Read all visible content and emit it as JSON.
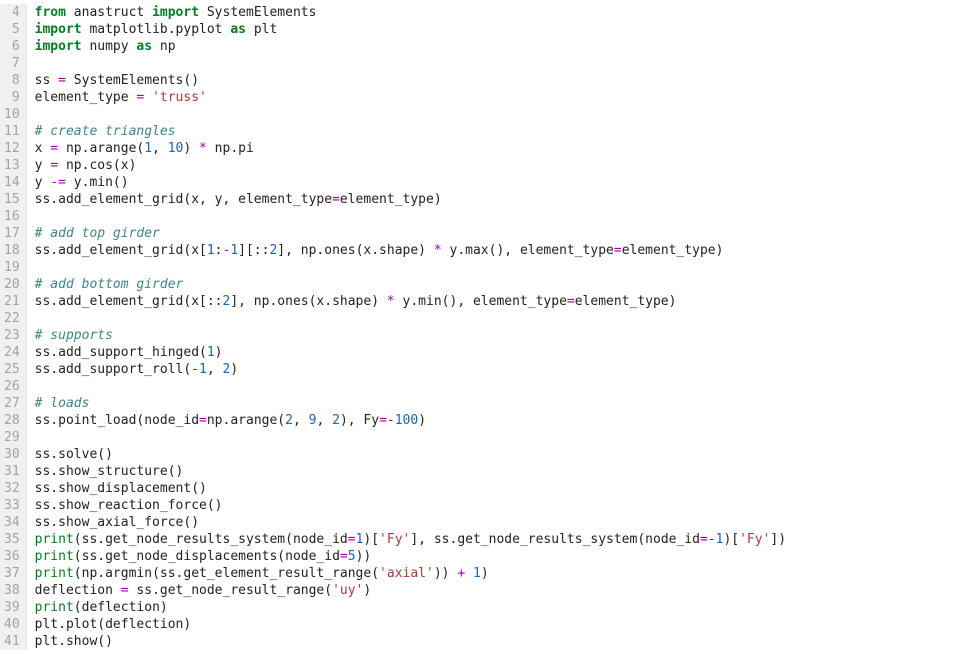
{
  "lines": [
    {
      "n": 4,
      "t": [
        [
          "kw",
          "from"
        ],
        [
          "",
          " anastruct "
        ],
        [
          "kw",
          "import"
        ],
        [
          "",
          " SystemElements"
        ]
      ]
    },
    {
      "n": 5,
      "t": [
        [
          "kw",
          "import"
        ],
        [
          "",
          " matplotlib.pyplot "
        ],
        [
          "kw",
          "as"
        ],
        [
          "",
          " plt"
        ]
      ]
    },
    {
      "n": 6,
      "t": [
        [
          "kw",
          "import"
        ],
        [
          "",
          " numpy "
        ],
        [
          "kw",
          "as"
        ],
        [
          "",
          " np"
        ]
      ]
    },
    {
      "n": 7,
      "t": []
    },
    {
      "n": 8,
      "t": [
        [
          "",
          "ss "
        ],
        [
          "opc",
          "="
        ],
        [
          "",
          " SystemElements()"
        ]
      ]
    },
    {
      "n": 9,
      "t": [
        [
          "",
          "element_type "
        ],
        [
          "opc",
          "="
        ],
        [
          "",
          " "
        ],
        [
          "str",
          "'truss'"
        ]
      ]
    },
    {
      "n": 10,
      "t": []
    },
    {
      "n": 11,
      "t": [
        [
          "com",
          "# create triangles"
        ]
      ]
    },
    {
      "n": 12,
      "t": [
        [
          "",
          "x "
        ],
        [
          "opc",
          "="
        ],
        [
          "",
          " np.arange("
        ],
        [
          "num",
          "1"
        ],
        [
          "",
          ", "
        ],
        [
          "num",
          "10"
        ],
        [
          "",
          ") "
        ],
        [
          "opc",
          "*"
        ],
        [
          "",
          " np.pi"
        ]
      ]
    },
    {
      "n": 13,
      "t": [
        [
          "",
          "y "
        ],
        [
          "opc",
          "="
        ],
        [
          "",
          " np.cos(x)"
        ]
      ]
    },
    {
      "n": 14,
      "t": [
        [
          "",
          "y "
        ],
        [
          "opc",
          "-="
        ],
        [
          "",
          " y.min()"
        ]
      ]
    },
    {
      "n": 15,
      "t": [
        [
          "",
          "ss.add_element_grid(x, y, element_type"
        ],
        [
          "opc",
          "="
        ],
        [
          "",
          "element_type)"
        ]
      ]
    },
    {
      "n": 16,
      "t": []
    },
    {
      "n": 17,
      "t": [
        [
          "com",
          "# add top girder"
        ]
      ]
    },
    {
      "n": 18,
      "t": [
        [
          "",
          "ss.add_element_grid(x["
        ],
        [
          "num",
          "1"
        ],
        [
          "",
          ":"
        ],
        [
          "opc",
          "-"
        ],
        [
          "num",
          "1"
        ],
        [
          "",
          "][::"
        ],
        [
          "num",
          "2"
        ],
        [
          "",
          "], np.ones(x.shape) "
        ],
        [
          "opc",
          "*"
        ],
        [
          "",
          " y.max(), element_type"
        ],
        [
          "opc",
          "="
        ],
        [
          "",
          "element_type)"
        ]
      ]
    },
    {
      "n": 19,
      "t": []
    },
    {
      "n": 20,
      "t": [
        [
          "com",
          "# add bottom girder"
        ]
      ]
    },
    {
      "n": 21,
      "t": [
        [
          "",
          "ss.add_element_grid(x[::"
        ],
        [
          "num",
          "2"
        ],
        [
          "",
          "], np.ones(x.shape) "
        ],
        [
          "opc",
          "*"
        ],
        [
          "",
          " y.min(), element_type"
        ],
        [
          "opc",
          "="
        ],
        [
          "",
          "element_type)"
        ]
      ]
    },
    {
      "n": 22,
      "t": []
    },
    {
      "n": 23,
      "t": [
        [
          "com",
          "# supports"
        ]
      ]
    },
    {
      "n": 24,
      "t": [
        [
          "",
          "ss.add_support_hinged("
        ],
        [
          "num",
          "1"
        ],
        [
          "",
          ")"
        ]
      ]
    },
    {
      "n": 25,
      "t": [
        [
          "",
          "ss.add_support_roll("
        ],
        [
          "opc",
          "-"
        ],
        [
          "num",
          "1"
        ],
        [
          "",
          ", "
        ],
        [
          "num",
          "2"
        ],
        [
          "",
          ")"
        ]
      ]
    },
    {
      "n": 26,
      "t": []
    },
    {
      "n": 27,
      "t": [
        [
          "com",
          "# loads"
        ]
      ]
    },
    {
      "n": 28,
      "t": [
        [
          "",
          "ss.point_load(node_id"
        ],
        [
          "opc",
          "="
        ],
        [
          "",
          "np.arange("
        ],
        [
          "num",
          "2"
        ],
        [
          "",
          ", "
        ],
        [
          "num",
          "9"
        ],
        [
          "",
          ", "
        ],
        [
          "num",
          "2"
        ],
        [
          "",
          "), Fy"
        ],
        [
          "opc",
          "=-"
        ],
        [
          "num",
          "100"
        ],
        [
          "",
          ")"
        ]
      ]
    },
    {
      "n": 29,
      "t": []
    },
    {
      "n": 30,
      "t": [
        [
          "",
          "ss.solve()"
        ]
      ]
    },
    {
      "n": 31,
      "t": [
        [
          "",
          "ss.show_structure()"
        ]
      ]
    },
    {
      "n": 32,
      "t": [
        [
          "",
          "ss.show_displacement()"
        ]
      ]
    },
    {
      "n": 33,
      "t": [
        [
          "",
          "ss.show_reaction_force()"
        ]
      ]
    },
    {
      "n": 34,
      "t": [
        [
          "",
          "ss.show_axial_force()"
        ]
      ]
    },
    {
      "n": 35,
      "t": [
        [
          "fn",
          "print"
        ],
        [
          "",
          "(ss.get_node_results_system(node_id"
        ],
        [
          "opc",
          "="
        ],
        [
          "num",
          "1"
        ],
        [
          "",
          ")["
        ],
        [
          "str",
          "'Fy'"
        ],
        [
          "",
          "], ss.get_node_results_system(node_id"
        ],
        [
          "opc",
          "=-"
        ],
        [
          "num",
          "1"
        ],
        [
          "",
          ")["
        ],
        [
          "str",
          "'Fy'"
        ],
        [
          "",
          "])"
        ]
      ]
    },
    {
      "n": 36,
      "t": [
        [
          "fn",
          "print"
        ],
        [
          "",
          "(ss.get_node_displacements(node_id"
        ],
        [
          "opc",
          "="
        ],
        [
          "num",
          "5"
        ],
        [
          "",
          "))"
        ]
      ]
    },
    {
      "n": 37,
      "t": [
        [
          "fn",
          "print"
        ],
        [
          "",
          "(np.argmin(ss.get_element_result_range("
        ],
        [
          "str",
          "'axial'"
        ],
        [
          "",
          ")) "
        ],
        [
          "opc",
          "+"
        ],
        [
          "",
          " "
        ],
        [
          "num",
          "1"
        ],
        [
          "",
          ")"
        ]
      ]
    },
    {
      "n": 38,
      "t": [
        [
          "",
          "deflection "
        ],
        [
          "opc",
          "="
        ],
        [
          "",
          " ss.get_node_result_range("
        ],
        [
          "str",
          "'uy'"
        ],
        [
          "",
          ")"
        ]
      ]
    },
    {
      "n": 39,
      "t": [
        [
          "fn",
          "print"
        ],
        [
          "",
          "(deflection)"
        ]
      ]
    },
    {
      "n": 40,
      "t": [
        [
          "",
          "plt.plot(deflection)"
        ]
      ]
    },
    {
      "n": 41,
      "t": [
        [
          "",
          "plt.show()"
        ]
      ]
    }
  ]
}
